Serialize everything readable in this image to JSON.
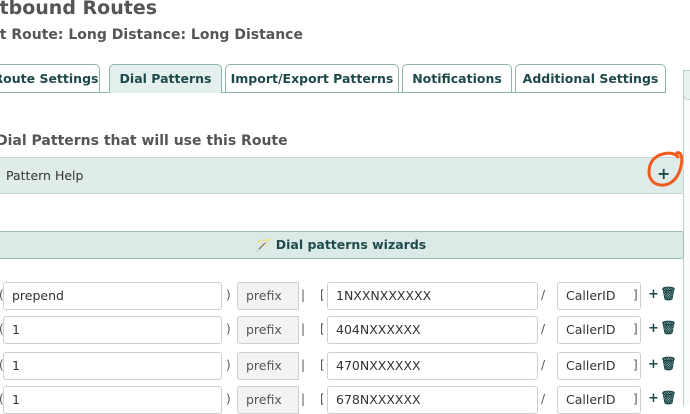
{
  "header": {
    "title": "utbound Routes",
    "subtitle": "it Route: Long Distance: Long Distance"
  },
  "tabs": [
    {
      "label": "Route Settings",
      "active": false
    },
    {
      "label": "Dial Patterns",
      "active": true
    },
    {
      "label": "Import/Export Patterns",
      "active": false
    },
    {
      "label": "Notifications",
      "active": false
    },
    {
      "label": "Additional Settings",
      "active": false
    }
  ],
  "dial_patterns": {
    "section_title": "Dial Patterns that will use this Route",
    "help_label": "Pattern Help",
    "help_toggle": "+",
    "wizard_label": "Dial patterns wizards",
    "rows": [
      {
        "prepend": "prepend",
        "prefix": "prefix",
        "match": "1NXXNXXXXXX",
        "callerid": "CallerID"
      },
      {
        "prepend": "1",
        "prefix": "prefix",
        "match": "404NXXXXXX",
        "callerid": "CallerID"
      },
      {
        "prepend": "1",
        "prefix": "prefix",
        "match": "470NXXXXXX",
        "callerid": "CallerID"
      },
      {
        "prepend": "1",
        "prefix": "prefix",
        "match": "678NXXXXXX",
        "callerid": "CallerID"
      }
    ],
    "symbols": {
      "open_paren": "(",
      "close_paren": ")",
      "pipe": "|",
      "open_bracket": "[",
      "slash": "/",
      "close_bracket": "]"
    },
    "row_action_add": "+",
    "row_action_delete": "🗑"
  },
  "colors": {
    "accent": "#1e4a4a",
    "tab_active_bg": "#e3f0ee",
    "help_bar_bg": "#dfecea",
    "annotation": "#f05a1a"
  }
}
